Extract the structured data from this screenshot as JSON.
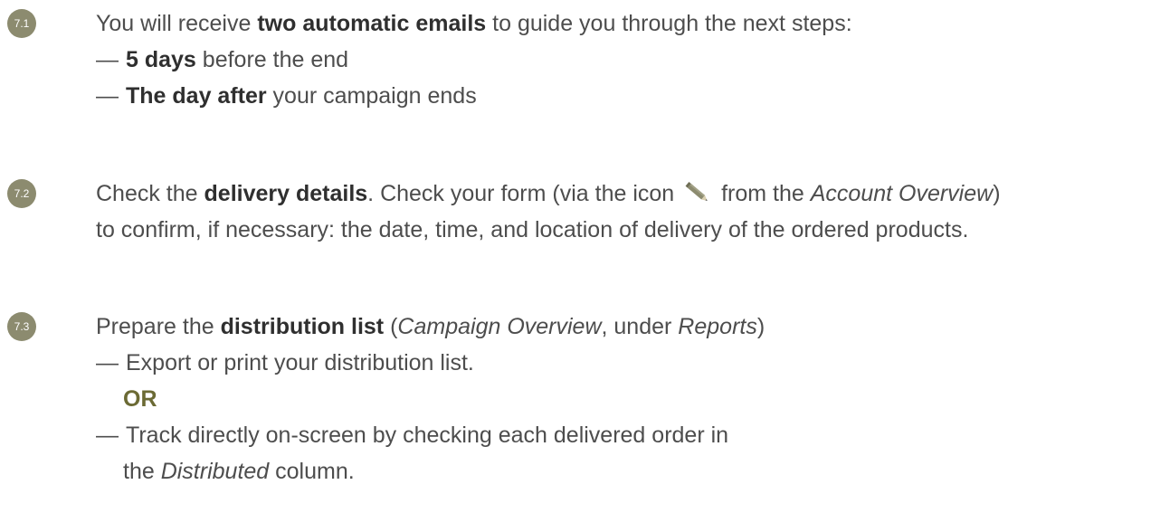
{
  "steps": [
    {
      "badge": "7.1",
      "line1": {
        "pre": "You will receive ",
        "bold": "two automatic emails",
        "post": " to guide you through the next steps:"
      },
      "bullets": [
        {
          "dash": "—",
          "bold": "5 days",
          "rest": " before the end"
        },
        {
          "dash": "—",
          "bold": "The day after",
          "rest": " your campaign ends"
        }
      ]
    },
    {
      "badge": "7.2",
      "line1": {
        "pre": "Check the ",
        "bold": "delivery details",
        "mid": ". Check your form (via the icon ",
        "icon": "pencil-icon",
        "post": " from the ",
        "italic": "Account Overview",
        "end": ")"
      },
      "line2": "to confirm, if necessary: the date, time, and location of delivery of the ordered products."
    },
    {
      "badge": "7.3",
      "line1": {
        "pre": "Prepare the ",
        "bold": "distribution list",
        "open": " (",
        "italic1": "Campaign Overview",
        "mid": ", under ",
        "italic2": "Reports",
        "close": ")"
      },
      "bullet1": {
        "dash": "—",
        "text": "Export or print your distribution list."
      },
      "or": "OR",
      "bullet2": {
        "dash": "—",
        "text": "Track directly on-screen by checking each delivered order in"
      },
      "continuation": {
        "pre": "the ",
        "italic": "Distributed",
        "post": " column."
      }
    }
  ],
  "colors": {
    "badge": "#8c8b6f",
    "text": "#4d4d4d",
    "or": "#6b6a34"
  }
}
